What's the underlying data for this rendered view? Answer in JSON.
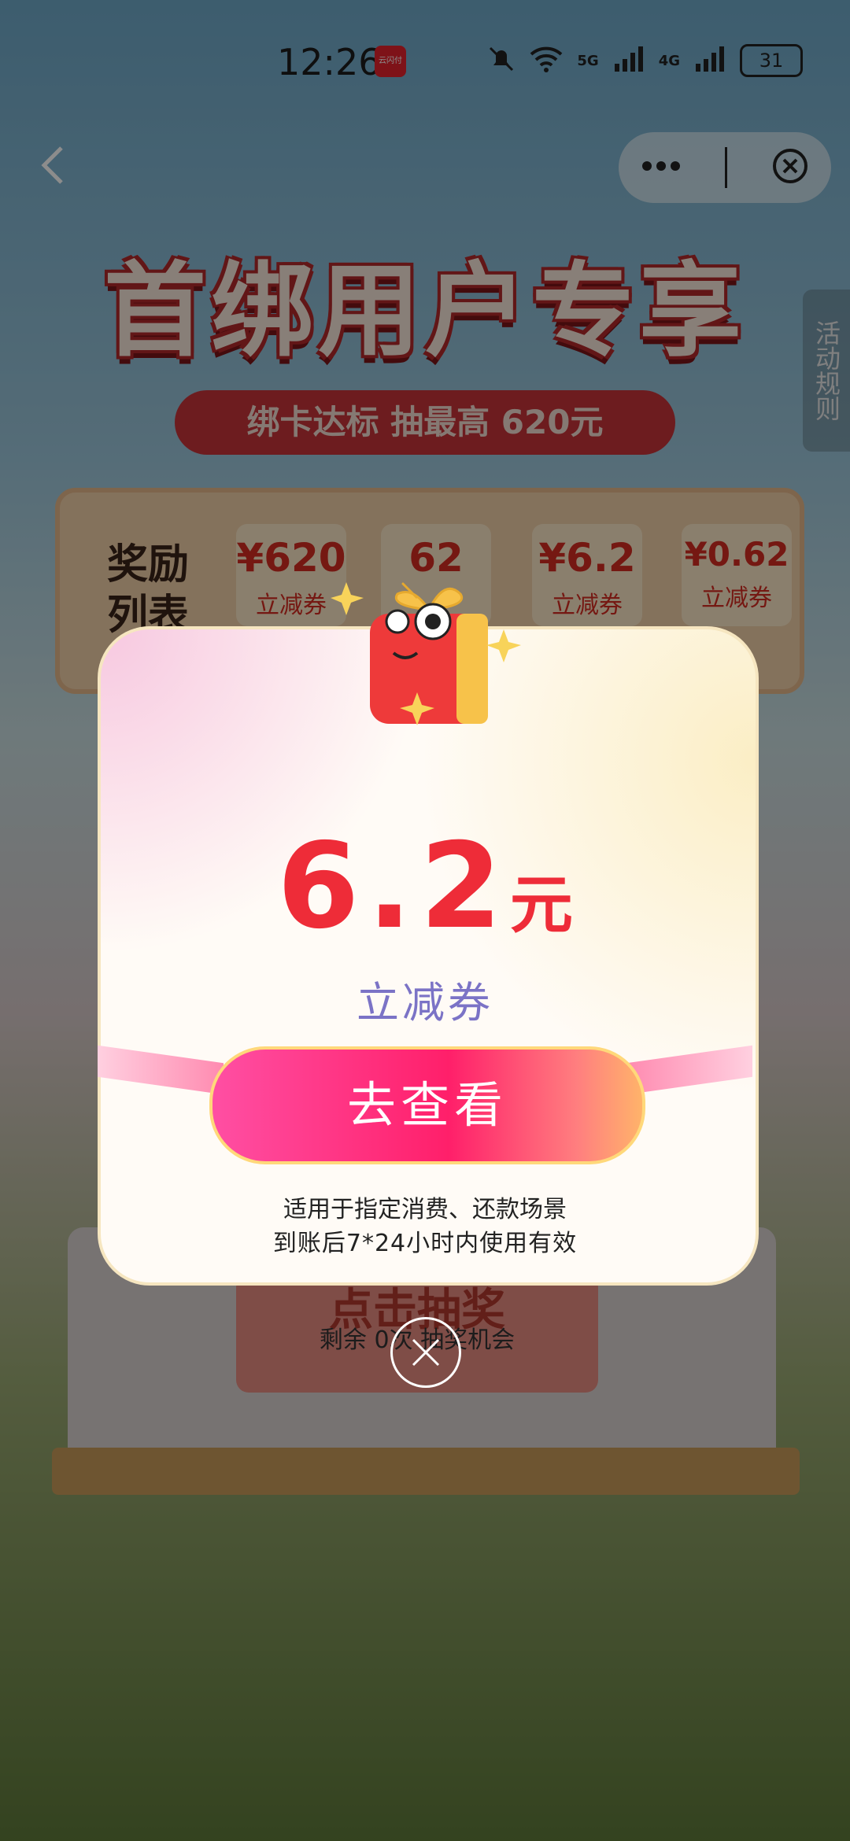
{
  "status_bar": {
    "time": "12:26",
    "app_badge": "云闪付",
    "network_5g": "5G",
    "network_4g": "4G",
    "battery": "31"
  },
  "nav": {
    "back_icon": "chevron-left-icon",
    "more_icon": "more-dots-icon",
    "close_icon": "close-circle-icon"
  },
  "banner": {
    "title": "首绑用户专享",
    "subtitle": "绑卡达标 抽最高 620元",
    "side_tab": "活动规则"
  },
  "rewards": {
    "label": "奖励列表",
    "items": [
      {
        "amount": "¥620",
        "type": "立减券"
      },
      {
        "amount": "62",
        "type": ""
      },
      {
        "amount": "¥6.2",
        "type": "立减券"
      },
      {
        "amount": "¥0.62",
        "type": "立减券"
      }
    ]
  },
  "machine": {
    "draw_label": "点击抽奖",
    "remaining": "剩余 0次 抽奖机会"
  },
  "popup": {
    "amount": "6.2",
    "unit": "元",
    "voucher_type": "立减券",
    "button_label": "去查看",
    "note_line1": "适用于指定消费、还款场景",
    "note_line2": "到账后7*24小时内使用有效"
  },
  "colors": {
    "accent_red": "#ee2c38",
    "voucher_purple": "#7b73c6",
    "button_pink": "#ff1f6a"
  }
}
